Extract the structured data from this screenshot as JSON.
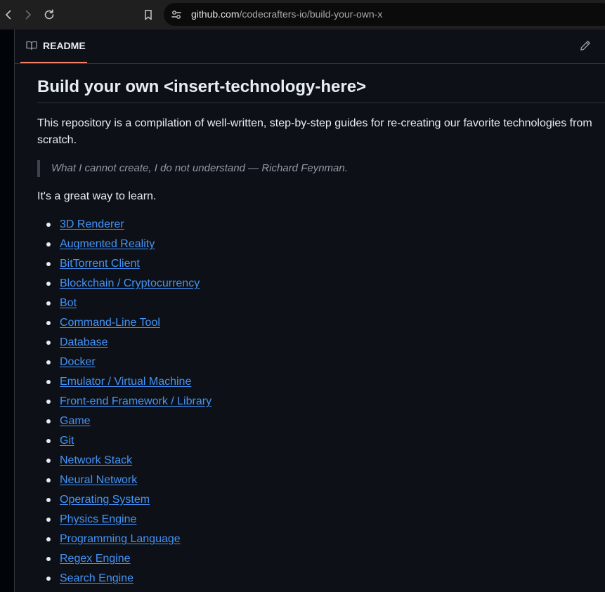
{
  "browser": {
    "url_domain": "github.com",
    "url_path": "/codecrafters-io/build-your-own-x"
  },
  "readme": {
    "tab_label": "README",
    "title": "Build your own <insert-technology-here>",
    "intro": "This repository is a compilation of well-written, step-by-step guides for re-creating our favorite technologies from scratch.",
    "quote": "What I cannot create, I do not understand — Richard Feynman.",
    "learn": "It's a great way to learn.",
    "topics": [
      "3D Renderer",
      "Augmented Reality",
      "BitTorrent Client",
      "Blockchain / Cryptocurrency",
      "Bot",
      "Command-Line Tool",
      "Database",
      "Docker",
      "Emulator / Virtual Machine",
      "Front-end Framework / Library",
      "Game",
      "Git",
      "Network Stack",
      "Neural Network",
      "Operating System",
      "Physics Engine",
      "Programming Language",
      "Regex Engine",
      "Search Engine"
    ]
  },
  "colors": {
    "page_bg": "#0d1117",
    "link": "#4493f8",
    "text": "#e6edf3",
    "muted": "#9198a1",
    "tab_underline": "#f78166"
  },
  "icons": {
    "back": "chevron-left-icon",
    "forward": "chevron-right-icon",
    "reload": "reload-icon",
    "bookmark": "bookmark-icon",
    "site_info": "site-settings-icon",
    "readme": "book-icon",
    "edit": "pencil-icon"
  }
}
